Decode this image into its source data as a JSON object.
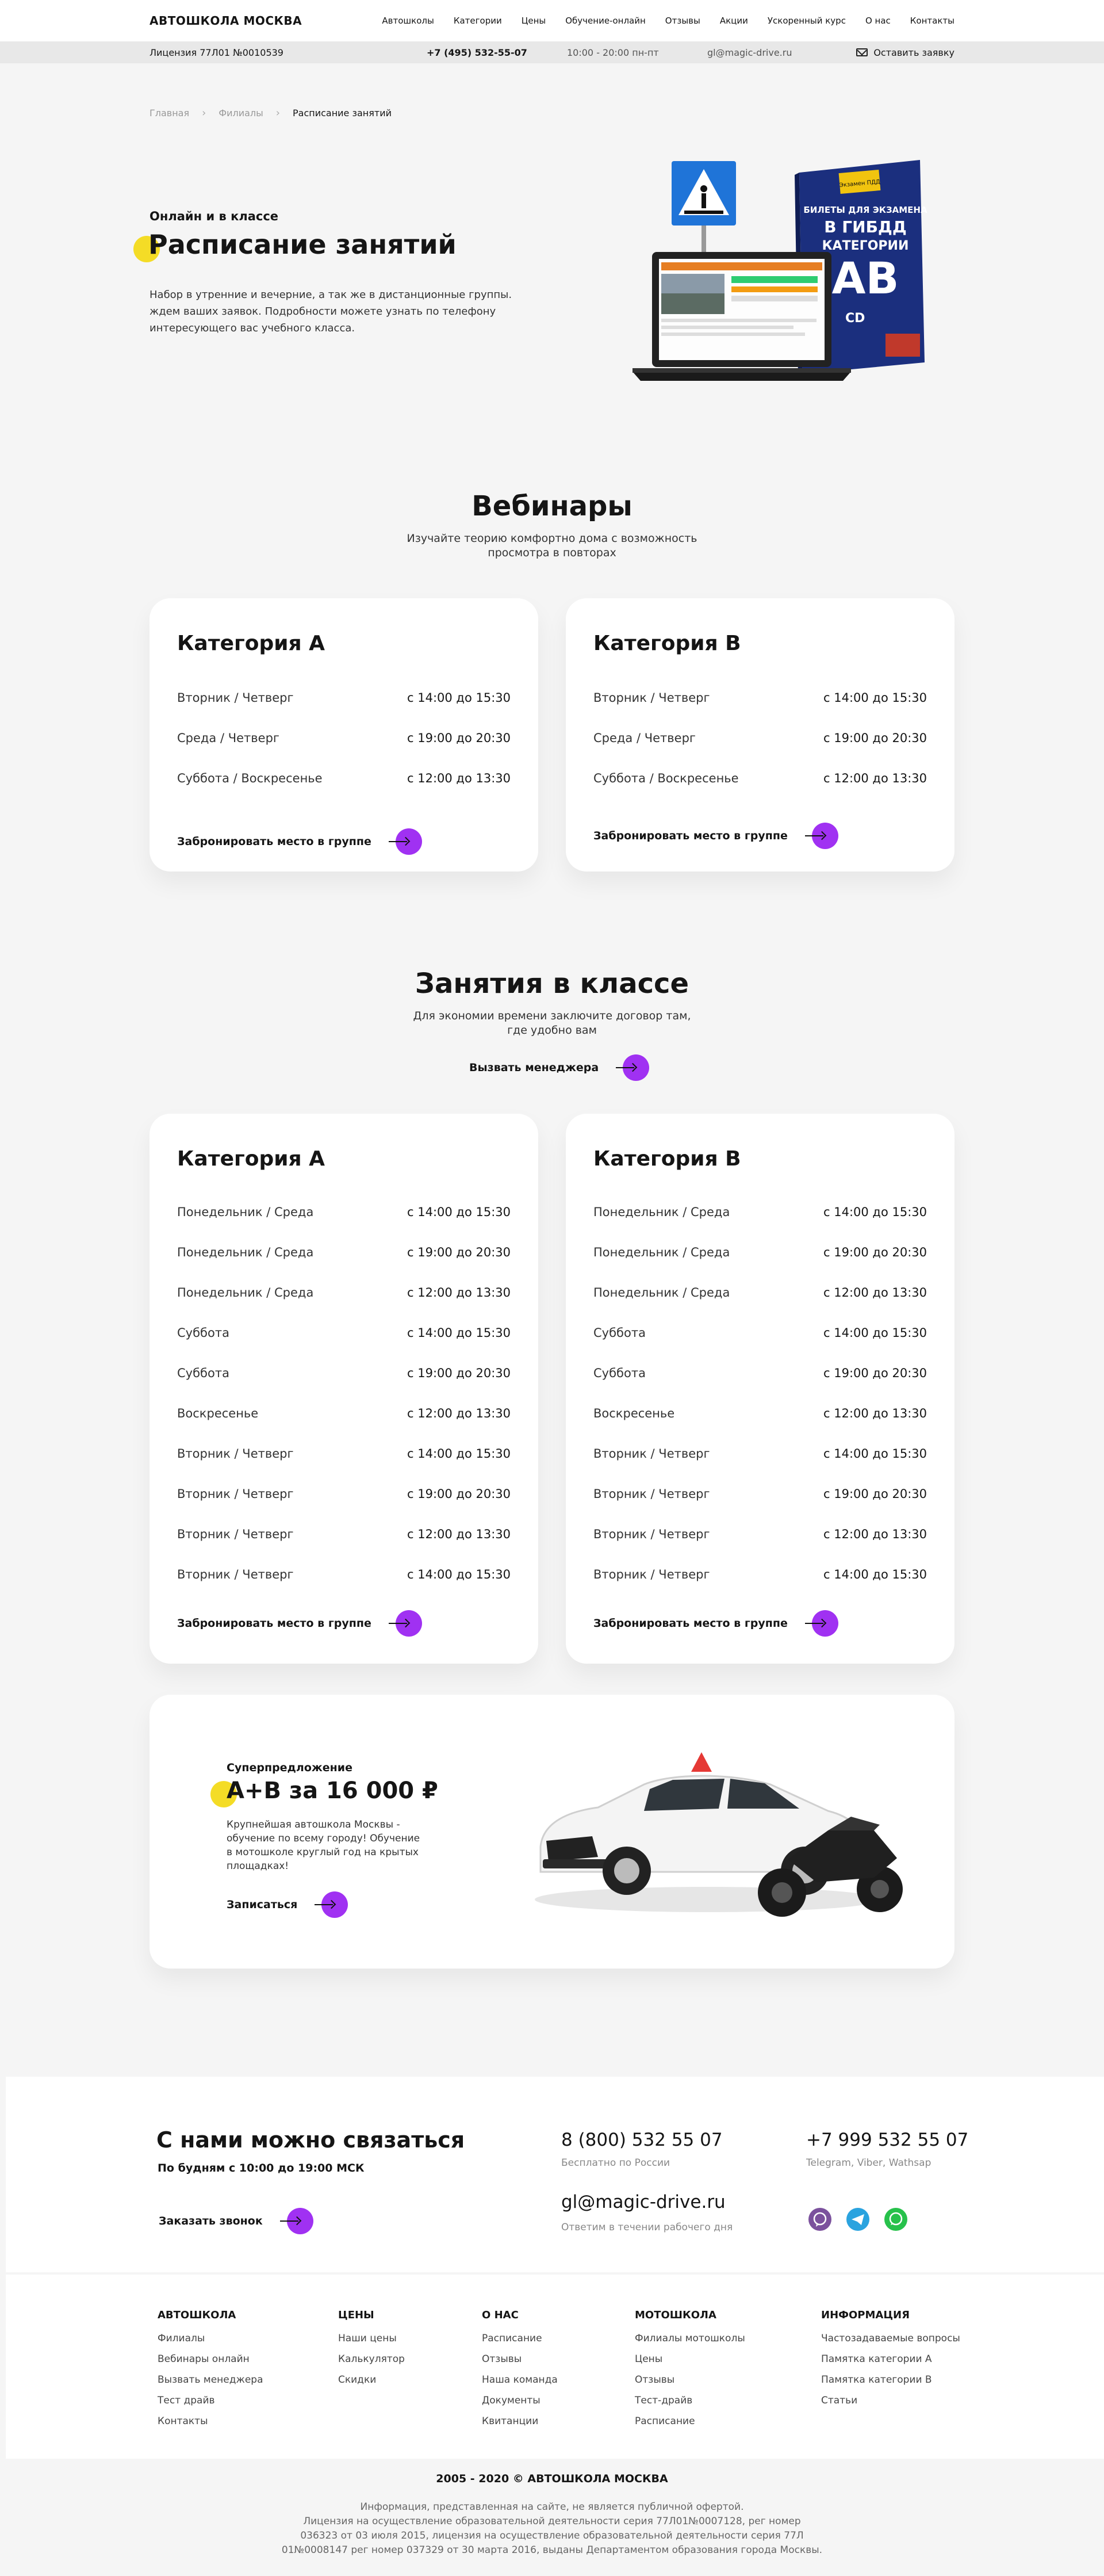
{
  "header": {
    "logo": "АВТОШКОЛА МОСКВА",
    "menu": [
      "Автошколы",
      "Категории",
      "Цены",
      "Обучение-онлайн",
      "Отзывы",
      "Акции",
      "Ускоренный курс",
      "О нас",
      "Контакты"
    ]
  },
  "infobar": {
    "license": "Лицензия 77Л01 №0010539",
    "phone": "+7 (495) 532-55-07",
    "hours": "10:00 - 20:00 пн-пт",
    "email": "gl@magic-drive.ru",
    "request": "Оставить заявку"
  },
  "breadcrumbs": [
    "Главная",
    "Филиалы",
    "Расписание занятий"
  ],
  "hero": {
    "eyebrow": "Онлайн и в классе",
    "title": "Расписание занятий",
    "text": "Набор в утренние и вечерние, а так же в дистанционные группы. ждем ваших заявок. Подробности можете узнать по телефону интересующего вас учебного класса.",
    "book_tag": "Экзамен ПДД",
    "book_title_1": "БИЛЕТЫ ДЛЯ ЭКЗАМЕНА",
    "book_title_2": "В ГИБДД",
    "book_title_3": "КАТЕГОРИИ",
    "book_letters": "AB",
    "book_cd": "CD"
  },
  "webinars": {
    "title": "Вебинары",
    "subtitle_1": "Изучайте теорию комфортно дома с возможность",
    "subtitle_2": "просмотра в повторах",
    "cards": [
      {
        "title": "Категория A",
        "rows": [
          {
            "days": "Вторник / Четверг",
            "time": "с 14:00 до 15:30"
          },
          {
            "days": "Среда / Четверг",
            "time": "с 19:00 до 20:30"
          },
          {
            "days": "Суббота / Воскресенье",
            "time": "с 12:00 до 13:30"
          }
        ],
        "cta": "Забронировать место в группе"
      },
      {
        "title": "Категория B",
        "rows": [
          {
            "days": "Вторник / Четверг",
            "time": "с 14:00 до 15:30"
          },
          {
            "days": "Среда / Четверг",
            "time": "с 19:00 до 20:30"
          },
          {
            "days": "Суббота / Воскресенье",
            "time": "с 12:00 до 13:30"
          }
        ],
        "cta": "Забронировать место в группе"
      }
    ]
  },
  "classes": {
    "title": "Занятия в классе",
    "subtitle_1": "Для экономии времени заключите договор там,",
    "subtitle_2": "где удобно вам",
    "cta": "Вызвать менеджера",
    "cards": [
      {
        "title": "Категория A",
        "rows": [
          {
            "days": "Понедельник / Среда",
            "time": "с 14:00 до 15:30"
          },
          {
            "days": "Понедельник / Среда",
            "time": "с 19:00 до 20:30"
          },
          {
            "days": "Понедельник / Среда",
            "time": "с 12:00 до 13:30"
          },
          {
            "days": "Суббота",
            "time": "с 14:00 до 15:30"
          },
          {
            "days": "Суббота",
            "time": "с 19:00 до 20:30"
          },
          {
            "days": "Воскресенье",
            "time": "с 12:00 до 13:30"
          },
          {
            "days": "Вторник / Четверг",
            "time": "с 14:00 до 15:30"
          },
          {
            "days": "Вторник / Четверг",
            "time": "с 19:00 до 20:30"
          },
          {
            "days": "Вторник / Четверг",
            "time": "с 12:00 до 13:30"
          },
          {
            "days": "Вторник / Четверг",
            "time": "с 14:00 до 15:30"
          }
        ],
        "cta": "Забронировать место в группе"
      },
      {
        "title": "Категория B",
        "rows": [
          {
            "days": "Понедельник / Среда",
            "time": "с 14:00 до 15:30"
          },
          {
            "days": "Понедельник / Среда",
            "time": "с 19:00 до 20:30"
          },
          {
            "days": "Понедельник / Среда",
            "time": "с 12:00 до 13:30"
          },
          {
            "days": "Суббота",
            "time": "с 14:00 до 15:30"
          },
          {
            "days": "Суббота",
            "time": "с 19:00 до 20:30"
          },
          {
            "days": "Воскресенье",
            "time": "с 12:00 до 13:30"
          },
          {
            "days": "Вторник / Четверг",
            "time": "с 14:00 до 15:30"
          },
          {
            "days": "Вторник / Четверг",
            "time": "с 19:00 до 20:30"
          },
          {
            "days": "Вторник / Четверг",
            "time": "с 12:00 до 13:30"
          },
          {
            "days": "Вторник / Четверг",
            "time": "с 14:00 до 15:30"
          }
        ],
        "cta": "Забронировать место в группе"
      }
    ]
  },
  "offer": {
    "eyebrow": "Суперпредложение",
    "title": "A+B за 16 000 ₽",
    "text": "Крупнейшая автошкола Москвы - обучение по всему городу! Обучение в мотошколе круглый год на крытых площадках!",
    "cta": "Записаться"
  },
  "contact": {
    "title": "С нами можно связаться",
    "hours": "По будням с 10:00 до 19:00 МСК",
    "cta": "Заказать звонок",
    "phone1": "8 (800) 532 55 07",
    "phone1_note": "Бесплатно по России",
    "phone2": "+7 999 532 55 07",
    "phone2_note": "Telegram, Viber, Wathsap",
    "email": "gl@magic-drive.ru",
    "email_note": "Ответим в течении рабочего дня"
  },
  "footer": {
    "columns": [
      {
        "title": "АВТОШКОЛА",
        "links": [
          "Филиалы",
          "Вебинары онлайн",
          "Вызвать менеджера",
          "Тест драйв",
          "Контакты"
        ]
      },
      {
        "title": "ЦЕНЫ",
        "links": [
          "Наши цены",
          "Калькулятор",
          "Скидки"
        ]
      },
      {
        "title": "О НАС",
        "links": [
          "Расписание",
          "Отзывы",
          "Наша команда",
          "Документы",
          "Квитанции"
        ]
      },
      {
        "title": "МОТОШКОЛА",
        "links": [
          "Филиалы мотошколы",
          "Цены",
          "Отзывы",
          "Тест-драйв",
          "Расписание"
        ]
      },
      {
        "title": "ИНФОРМАЦИЯ",
        "links": [
          "Частозадаваемые вопросы",
          "Памятка категории A",
          "Памятка категории B",
          "Статьи"
        ]
      }
    ],
    "copyright": "2005 - 2020 © АВТОШКОЛА МОСКВА",
    "legal_1": "Информация, представленная на сайте, не является публичной офертой.",
    "legal_2": "Лицензия на осуществление образовательной деятельности серия 77Л01№0007128, рег номер",
    "legal_3": "036323 от 03 июля 2015, лицензия на осуществление образовательной деятельности серия 77Л",
    "legal_4": "01№0008147 рег номер 037329 от 30 марта 2016, выданы Департаментом образования города Москвы."
  },
  "colors": {
    "accent": "#a031f2",
    "dot": "#f4dc26",
    "background": "#f5f5f5"
  }
}
